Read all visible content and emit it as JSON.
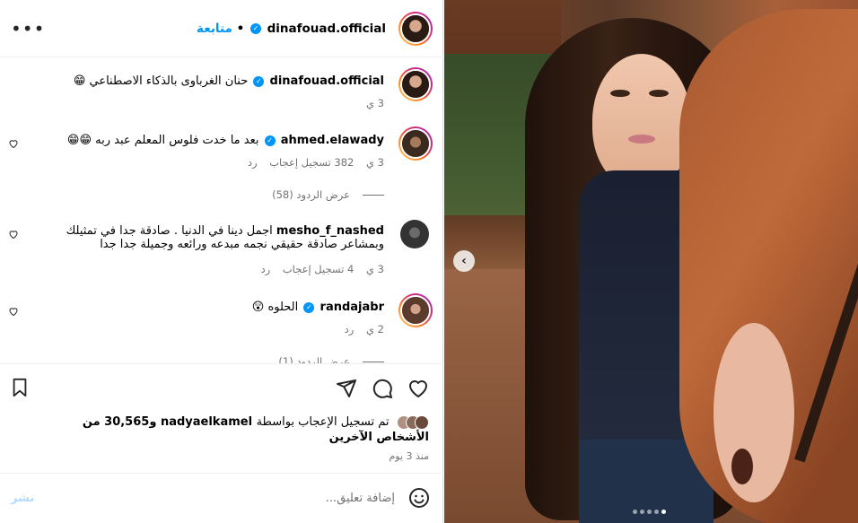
{
  "header": {
    "username": "dinafouad.official",
    "separator": "•",
    "follow_label": "متابعة",
    "more_icon": "more-horizontal-icon"
  },
  "caption": {
    "username": "dinafouad.official",
    "text": "حنان الغرباوى بالذكاء الاصطناعي 😁",
    "time": "3 ي"
  },
  "comments": [
    {
      "username": "ahmed.elawady",
      "verified": true,
      "text": "بعد ما خدت فلوس المعلم عبد ربه 😁😁",
      "time": "3 ي",
      "likes": "382 تسجيل إعجاب",
      "reply": "رد",
      "view_replies": "عرض الردود (58)"
    },
    {
      "username": "mesho_f_nashed",
      "verified": false,
      "text": "اجمل دينا في الدنيا . صادقة جدا في تمثيلك وبمشاعر صادقة حقيقي نجمه مبدعه ورائعه وجميلة جدا جدا",
      "time": "3 ي",
      "likes": "4 تسجيل إعجاب",
      "reply": "رد"
    },
    {
      "username": "randajabr",
      "verified": true,
      "text": "الحلوه 😲",
      "time": "2 ي",
      "reply": "رد",
      "view_replies": "عرض الردود (1)"
    }
  ],
  "likes_summary": {
    "prefix": "تم تسجيل الإعجاب بواسطة",
    "user": "nadyaelkamel",
    "and": "و",
    "others": "30,565 من الأشخاص الآخرين"
  },
  "post_date": "منذ 3 يوم",
  "comment_input": {
    "placeholder": "إضافة تعليق...",
    "post_label": "نشر"
  },
  "carousel": {
    "total": 5,
    "current": 5
  }
}
